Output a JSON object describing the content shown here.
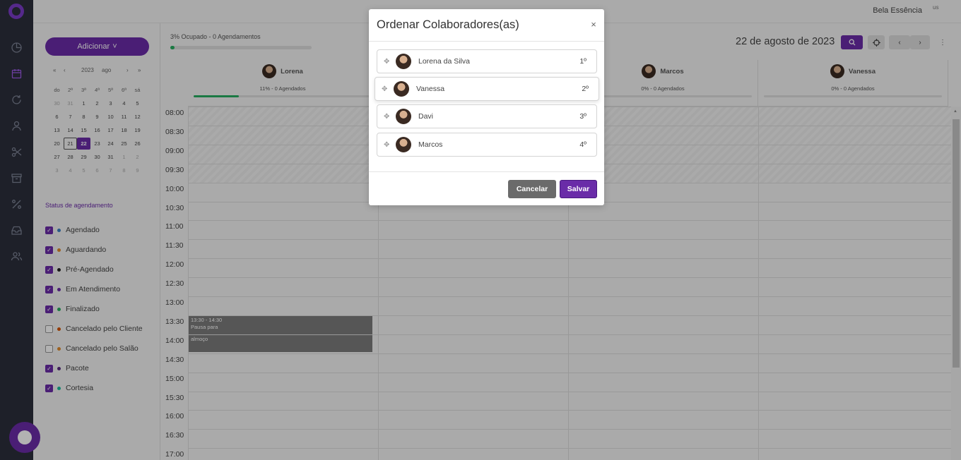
{
  "topbar": {
    "company": "Bela Essência",
    "flag_alt": "us"
  },
  "sidebar": {
    "items": [
      {
        "icon": "dashboard-icon",
        "active": false
      },
      {
        "icon": "calendar-icon",
        "active": true
      },
      {
        "icon": "refresh-icon",
        "active": false
      },
      {
        "icon": "user-icon",
        "active": false
      },
      {
        "icon": "scissors-icon",
        "active": false
      },
      {
        "icon": "archive-icon",
        "active": false
      },
      {
        "icon": "percent-icon",
        "active": false
      },
      {
        "icon": "inbox-icon",
        "active": false
      },
      {
        "icon": "users-icon",
        "active": false
      }
    ]
  },
  "left": {
    "add_label": "Adicionar",
    "add_caret": "˅",
    "calendar": {
      "prev_year": "«",
      "prev_month": "‹",
      "year": "2023",
      "month": "ago",
      "next_month": "›",
      "next_year": "»",
      "weekdays": [
        "do",
        "2ª",
        "3ª",
        "4ª",
        "5ª",
        "6ª",
        "sá"
      ],
      "weeks": [
        [
          {
            "d": "30",
            "m": true
          },
          {
            "d": "31",
            "m": true
          },
          {
            "d": "1"
          },
          {
            "d": "2"
          },
          {
            "d": "3"
          },
          {
            "d": "4"
          },
          {
            "d": "5"
          }
        ],
        [
          {
            "d": "6"
          },
          {
            "d": "7"
          },
          {
            "d": "8"
          },
          {
            "d": "9"
          },
          {
            "d": "10"
          },
          {
            "d": "11"
          },
          {
            "d": "12"
          }
        ],
        [
          {
            "d": "13"
          },
          {
            "d": "14"
          },
          {
            "d": "15"
          },
          {
            "d": "16"
          },
          {
            "d": "17"
          },
          {
            "d": "18"
          },
          {
            "d": "19"
          }
        ],
        [
          {
            "d": "20"
          },
          {
            "d": "21",
            "today": true
          },
          {
            "d": "22",
            "sel": true
          },
          {
            "d": "23"
          },
          {
            "d": "24"
          },
          {
            "d": "25"
          },
          {
            "d": "26"
          }
        ],
        [
          {
            "d": "27"
          },
          {
            "d": "28"
          },
          {
            "d": "29"
          },
          {
            "d": "30"
          },
          {
            "d": "31"
          },
          {
            "d": "1",
            "m": true
          },
          {
            "d": "2",
            "m": true
          }
        ],
        [
          {
            "d": "3",
            "m": true
          },
          {
            "d": "4",
            "m": true
          },
          {
            "d": "5",
            "m": true
          },
          {
            "d": "6",
            "m": true
          },
          {
            "d": "7",
            "m": true
          },
          {
            "d": "8",
            "m": true
          },
          {
            "d": "9",
            "m": true
          }
        ]
      ]
    },
    "status_title": "Status de agendamento",
    "statuses": [
      {
        "label": "Agendado",
        "checked": true,
        "color": "#3b82c4"
      },
      {
        "label": "Aguardando",
        "checked": true,
        "color": "#e08a2c"
      },
      {
        "label": "Pré-Agendado",
        "checked": true,
        "color": "#222222"
      },
      {
        "label": "Em Atendimento",
        "checked": true,
        "color": "#6a2ca8"
      },
      {
        "label": "Finalizado",
        "checked": true,
        "color": "#27ae60"
      },
      {
        "label": "Cancelado pelo Cliente",
        "checked": false,
        "color": "#d35400"
      },
      {
        "label": "Cancelado pelo Salão",
        "checked": false,
        "color": "#e08a2c"
      },
      {
        "label": "Pacote",
        "checked": true,
        "color": "#5a2d82"
      },
      {
        "label": "Cortesia",
        "checked": true,
        "color": "#1abc9c"
      }
    ]
  },
  "main": {
    "occupancy": "3% Ocupado - 0 Agendamentos",
    "occupancy_fraction": 0.03,
    "date_title": "22 de agosto de 2023",
    "more_icon": "⋮",
    "columns": [
      {
        "name": "Lorena",
        "count": "11% - 0 Agendados",
        "fill": 0.11
      },
      {
        "name": "",
        "count": "",
        "fill": 0
      },
      {
        "name": "Marcos",
        "count": "0% - 0 Agendados",
        "fill": 0
      },
      {
        "name": "Vanessa",
        "count": "0% - 0 Agendados",
        "fill": 0
      }
    ],
    "times": [
      "08:00",
      "08:30",
      "09:00",
      "09:30",
      "10:00",
      "10:30",
      "11:00",
      "11:30",
      "12:00",
      "12:30",
      "13:00",
      "13:30",
      "14:00",
      "14:30",
      "15:00",
      "15:30",
      "16:00",
      "16:30",
      "17:00"
    ],
    "event": {
      "time": "13:30 - 14:30",
      "line1": "Pausa para",
      "line2": "almoço"
    }
  },
  "modal": {
    "title": "Ordenar Colaboradores(as)",
    "close": "×",
    "items": [
      {
        "name": "Lorena da Silva",
        "position": "1º"
      },
      {
        "name": "Vanessa",
        "position": "2º"
      },
      {
        "name": "Davi",
        "position": "3º"
      },
      {
        "name": "Marcos",
        "position": "4º"
      }
    ],
    "cancel": "Cancelar",
    "save": "Salvar"
  }
}
